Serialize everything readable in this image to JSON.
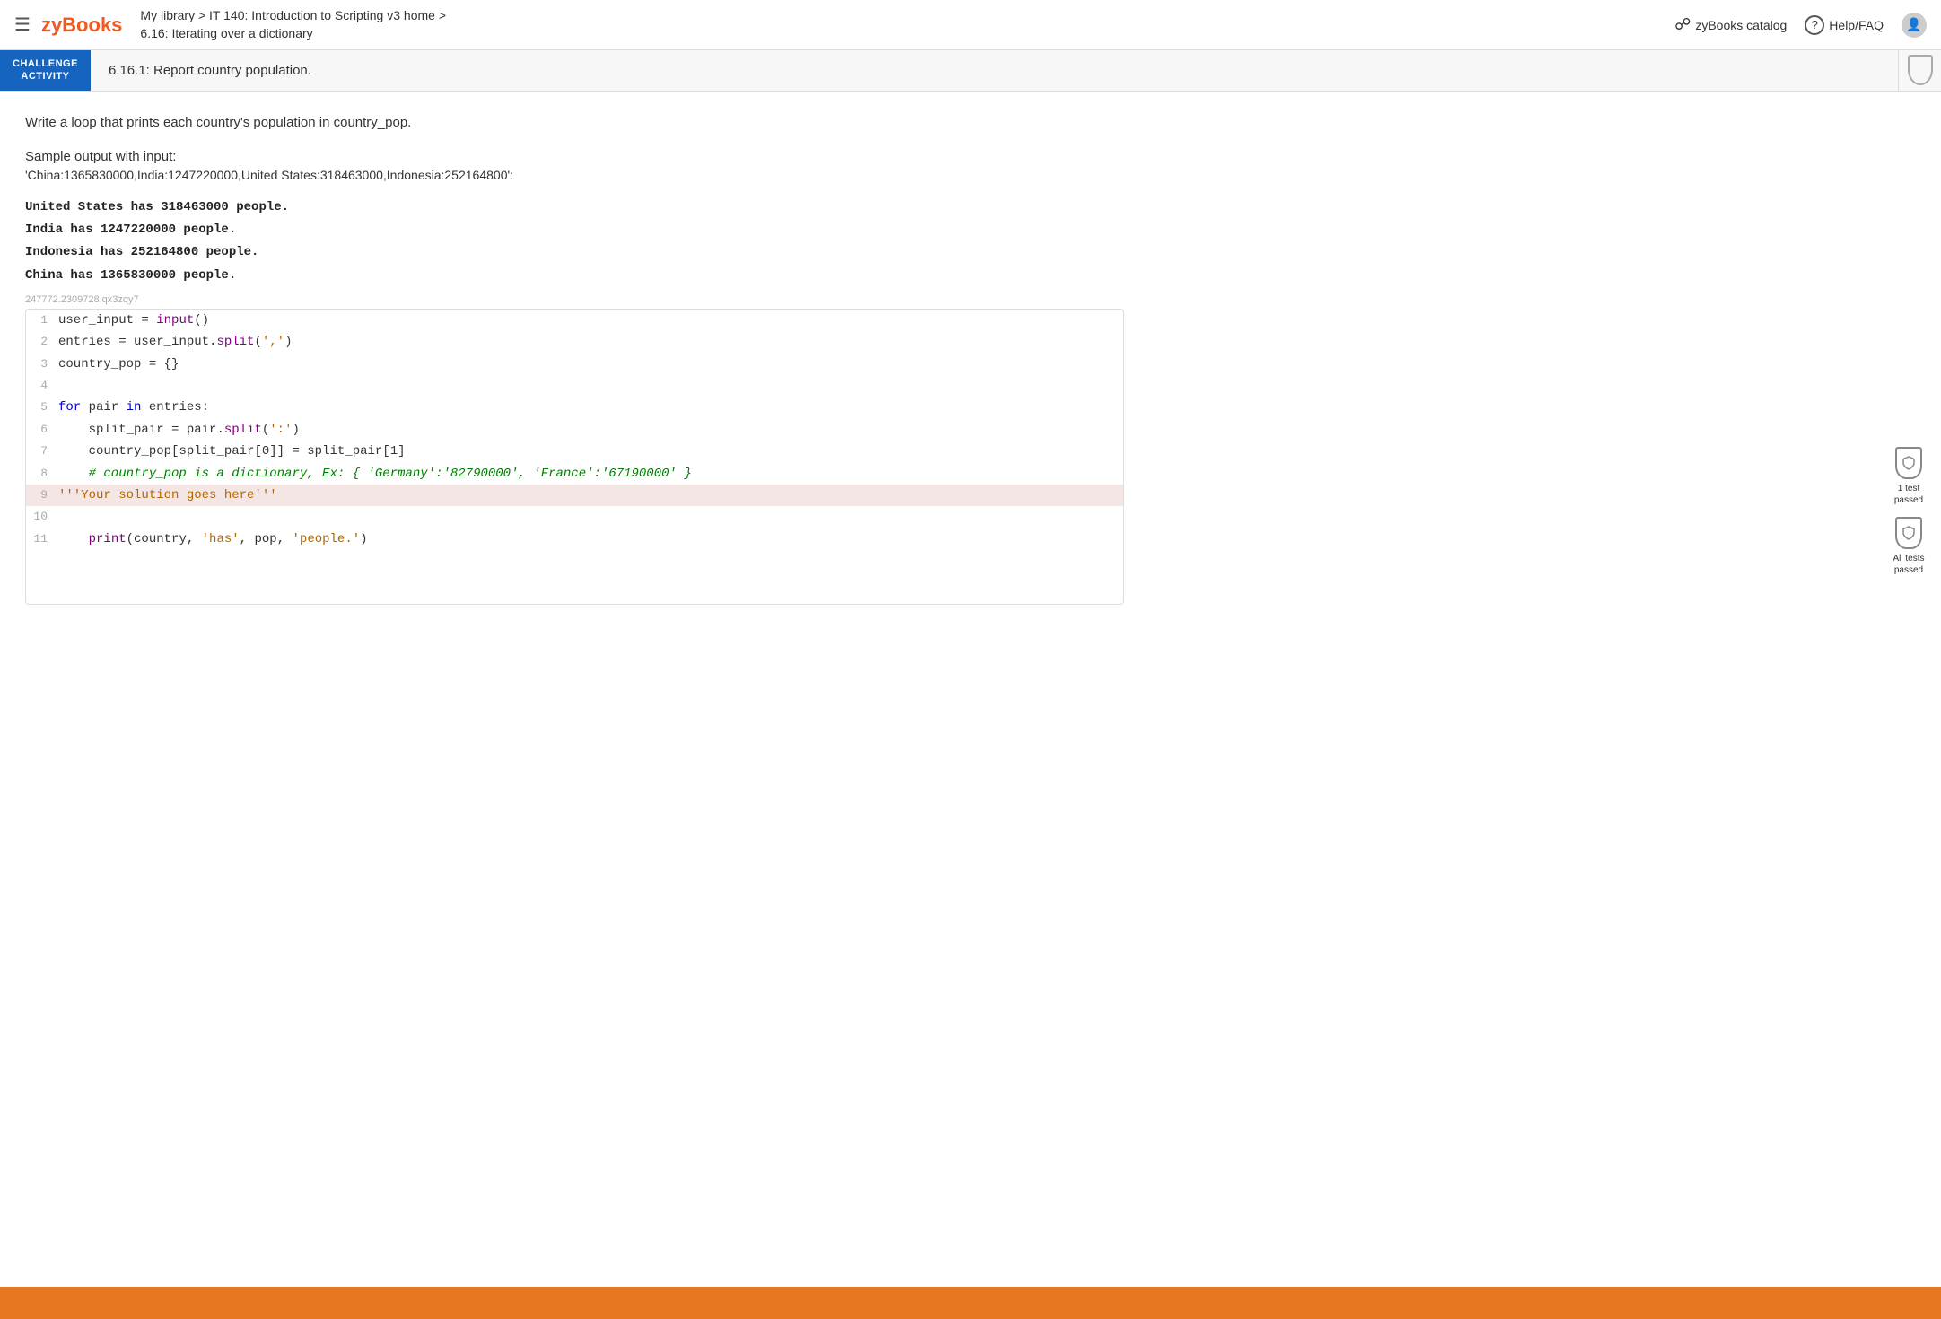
{
  "topbar": {
    "logo": "zyBooks",
    "breadcrumb_line1": "My library > IT 140: Introduction to Scripting v3 home >",
    "breadcrumb_line2": "6.16: Iterating over a dictionary",
    "catalog_label": "zyBooks catalog",
    "help_label": "Help/FAQ"
  },
  "challenge": {
    "label_line1": "CHALLENGE",
    "label_line2": "ACTIVITY",
    "title": "6.16.1: Report country population."
  },
  "description": "Write a loop that prints each country's population in country_pop.",
  "sample_output": {
    "label": "Sample output with input:",
    "input_value": "'China:1365830000,India:1247220000,United States:318463000,Indonesia:252164800':",
    "lines": [
      "United States has 318463000 people.",
      "India has 1247220000 people.",
      "Indonesia has 252164800 people.",
      "China has 1365830000 people."
    ]
  },
  "editor": {
    "id": "247772.2309728.qx3zqy7",
    "lines": [
      {
        "num": 1,
        "text": "user_input = input()",
        "highlighted": false
      },
      {
        "num": 2,
        "text": "entries = user_input.split(',')",
        "highlighted": false
      },
      {
        "num": 3,
        "text": "country_pop = {}",
        "highlighted": false
      },
      {
        "num": 4,
        "text": "",
        "highlighted": false
      },
      {
        "num": 5,
        "text": "for pair in entries:",
        "highlighted": false
      },
      {
        "num": 6,
        "text": "    split_pair = pair.split(':')",
        "highlighted": false
      },
      {
        "num": 7,
        "text": "    country_pop[split_pair[0]] = split_pair[1]",
        "highlighted": false
      },
      {
        "num": 8,
        "text": "    # country_pop is a dictionary, Ex: { 'Germany':'82790000', 'France':'67190000' }",
        "highlighted": false
      },
      {
        "num": 9,
        "text": "'''Your solution goes here'''",
        "highlighted": true
      },
      {
        "num": 10,
        "text": "",
        "highlighted": false
      },
      {
        "num": 11,
        "text": "    print(country, 'has', pop, 'people.')",
        "highlighted": false
      }
    ]
  },
  "badges": {
    "test1": {
      "label": "1 test\npassed"
    },
    "all_tests": {
      "label": "All tests\npassed"
    }
  }
}
